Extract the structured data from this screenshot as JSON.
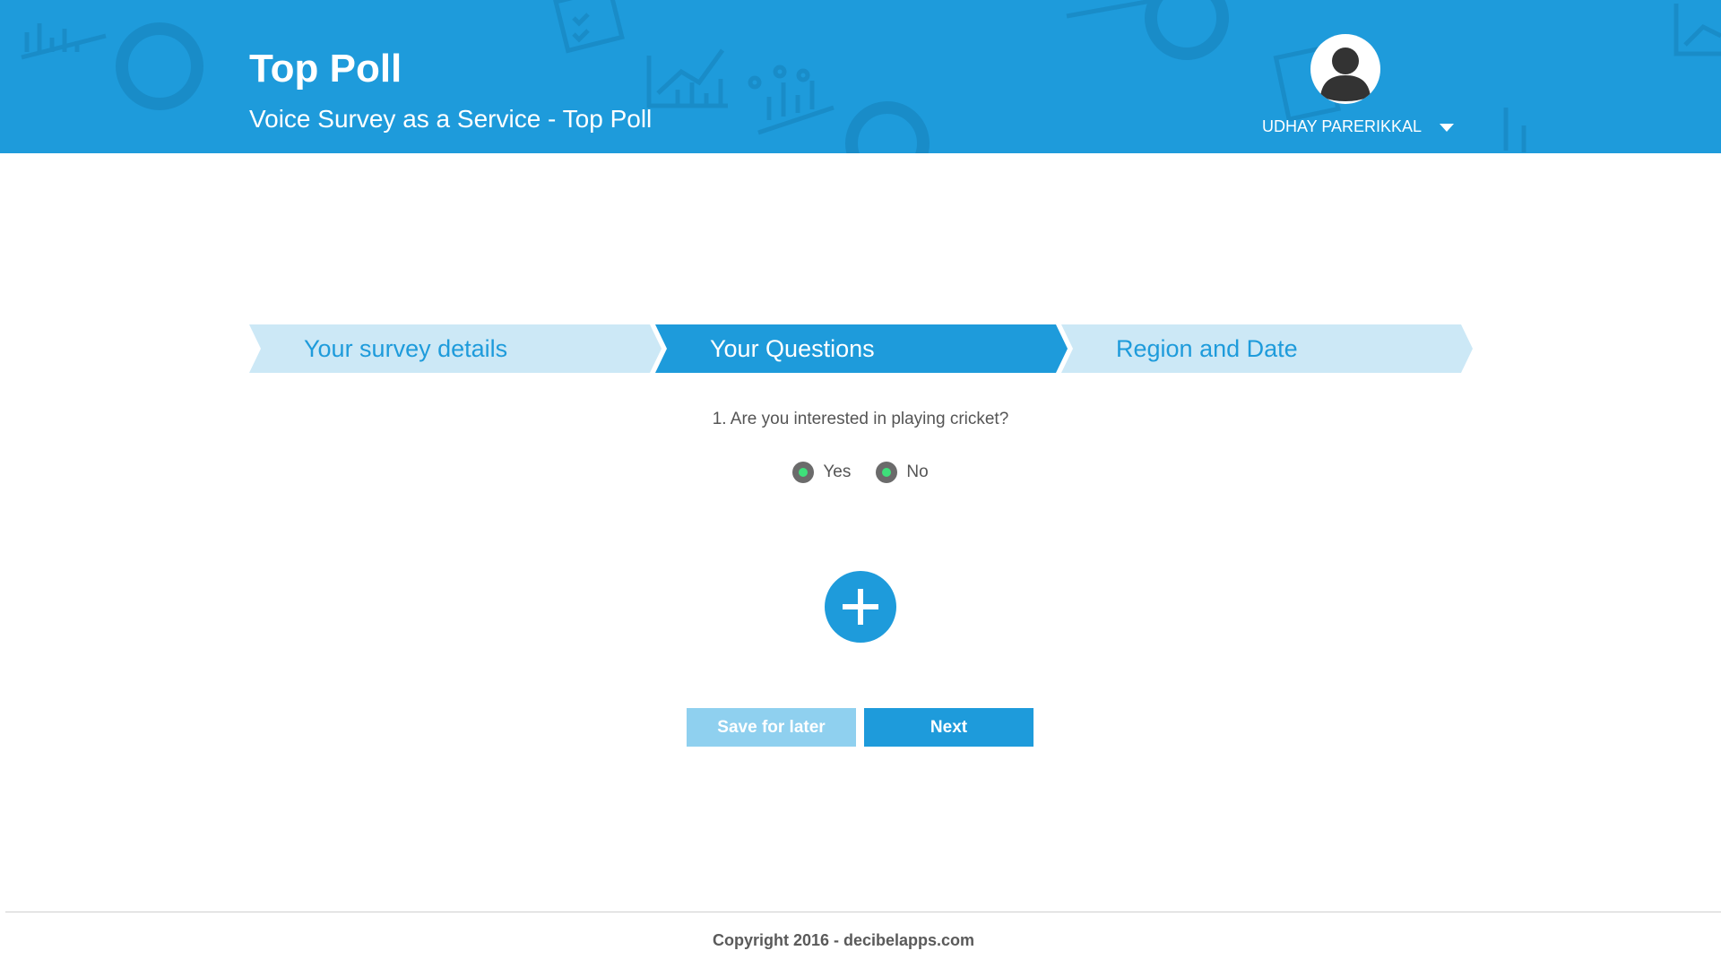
{
  "header": {
    "title": "Top Poll",
    "subtitle": "Voice Survey as a Service - Top Poll",
    "background_color": "#1e9bdb"
  },
  "user": {
    "name": "UDHAY PARERIKKAL",
    "avatar_icon": "user-avatar-icon",
    "menu_icon": "caret-down-icon"
  },
  "stepper": {
    "steps": [
      {
        "label": "Your survey details",
        "state": "completed"
      },
      {
        "label": "Your Questions",
        "state": "active"
      },
      {
        "label": "Region and Date",
        "state": "upcoming"
      }
    ],
    "active_color": "#1e9bdb",
    "inactive_color": "#cce8f6"
  },
  "question": {
    "text": "1. Are you interested in playing cricket?",
    "options": [
      {
        "label": "Yes"
      },
      {
        "label": "No"
      }
    ],
    "radio_color": "#6b6b6b",
    "radio_dot_color": "#3ee07a"
  },
  "add_question": {
    "icon": "plus-icon"
  },
  "actions": {
    "save_label": "Save for later",
    "next_label": "Next"
  },
  "footer": {
    "copyright": "Copyright 2016 - decibelapps.com"
  }
}
